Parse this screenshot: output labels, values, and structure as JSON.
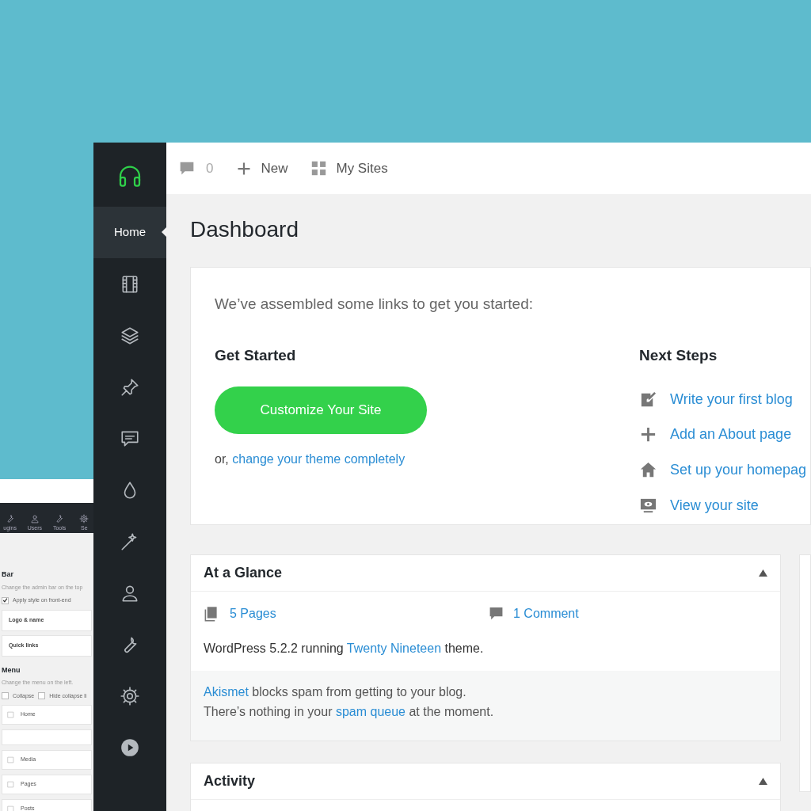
{
  "back_window": {
    "toolbar": [
      {
        "label": "ugins"
      },
      {
        "label": "Users"
      },
      {
        "label": "Tools"
      },
      {
        "label": "Se"
      }
    ],
    "rows": [
      {
        "kind": "heading",
        "text": "Bar"
      },
      {
        "kind": "hint",
        "text": "Change the admin bar on the top"
      },
      {
        "kind": "checkbox",
        "text": "Apply style on front-end",
        "checked": true
      },
      {
        "kind": "field",
        "text": "Logo & name"
      },
      {
        "kind": "field",
        "text": "Quick links"
      },
      {
        "kind": "heading",
        "text": "Menu"
      },
      {
        "kind": "hint",
        "text": "Change the menu on the left."
      },
      {
        "kind": "checkboxes",
        "items": [
          {
            "text": "Collapse",
            "checked": false
          },
          {
            "text": "Hide collapse li",
            "checked": false
          }
        ]
      },
      {
        "kind": "menu",
        "text": "Home"
      },
      {
        "kind": "blank"
      },
      {
        "kind": "menu",
        "text": "Media"
      },
      {
        "kind": "menu",
        "text": "Pages"
      },
      {
        "kind": "menu",
        "text": "Posts"
      }
    ]
  },
  "sidebar": {
    "items": [
      {
        "label": "Home",
        "selected": true
      },
      {
        "selected": false
      },
      {
        "selected": false
      },
      {
        "selected": false
      },
      {
        "selected": false
      },
      {
        "selected": false
      },
      {
        "selected": false
      },
      {
        "selected": false
      },
      {
        "selected": false
      },
      {
        "selected": false
      },
      {
        "selected": false
      }
    ]
  },
  "top_bar": {
    "comment_count": "0",
    "new": "New",
    "my_sites": "My Sites"
  },
  "page_title": "Dashboard",
  "welcome": {
    "intro": "We’ve assembled some links to get you started:",
    "get_started": {
      "title": "Get Started",
      "button": "Customize Your Site",
      "alt": [
        {
          "kind": "text",
          "text": "or, "
        },
        {
          "kind": "link",
          "text": "change your theme completely"
        }
      ]
    },
    "next_steps": {
      "title": "Next Steps",
      "items": [
        "Write your first blog",
        "Add an About page",
        "Set up your homepag",
        "View your site"
      ]
    }
  },
  "at_a_glance": {
    "title": "At a Glance",
    "expanded": true,
    "pages": "5 Pages",
    "comments": "1 Comment",
    "version": [
      {
        "kind": "text",
        "text": "WordPress 5.2.2 running "
      },
      {
        "kind": "link",
        "text": "Twenty Nineteen"
      },
      {
        "kind": "text",
        "text": " theme."
      }
    ],
    "footer": [
      [
        {
          "kind": "link",
          "text": "Akismet"
        },
        {
          "kind": "text",
          "text": " blocks spam from getting to your blog."
        }
      ],
      [
        {
          "kind": "text",
          "text": "There’s nothing in your "
        },
        {
          "kind": "link",
          "text": "spam queue"
        },
        {
          "kind": "text",
          "text": " at the moment."
        }
      ]
    ]
  },
  "activity": {
    "title": "Activity",
    "expanded": true
  }
}
